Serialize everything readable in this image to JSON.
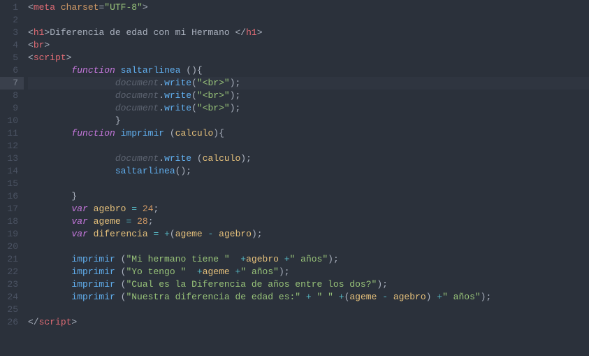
{
  "lines": [
    {
      "n": 1,
      "hl": false,
      "s": [
        [
          "p",
          "<"
        ],
        [
          "t",
          "meta"
        ],
        [
          "p",
          " "
        ],
        [
          "a",
          "charset"
        ],
        [
          "p",
          "="
        ],
        [
          "s",
          "\"UTF-8\""
        ],
        [
          "p",
          ">"
        ]
      ]
    },
    {
      "n": 2,
      "hl": false,
      "s": []
    },
    {
      "n": 3,
      "hl": false,
      "s": [
        [
          "p",
          "<"
        ],
        [
          "t",
          "h1"
        ],
        [
          "p",
          ">"
        ],
        [
          "p",
          "Diferencia de edad con mi Hermano "
        ],
        [
          "p",
          "</"
        ],
        [
          "t",
          "h1"
        ],
        [
          "p",
          ">"
        ]
      ]
    },
    {
      "n": 4,
      "hl": false,
      "s": [
        [
          "p",
          "<"
        ],
        [
          "t",
          "br"
        ],
        [
          "p",
          ">"
        ]
      ]
    },
    {
      "n": 5,
      "hl": false,
      "s": [
        [
          "p",
          "<"
        ],
        [
          "t",
          "script"
        ],
        [
          "p",
          ">"
        ]
      ]
    },
    {
      "n": 6,
      "hl": false,
      "s": [
        [
          "p",
          "        "
        ],
        [
          "k",
          "function"
        ],
        [
          "p",
          " "
        ],
        [
          "fn",
          "saltarlinea"
        ],
        [
          "p",
          " (){ "
        ]
      ]
    },
    {
      "n": 7,
      "hl": true,
      "s": [
        [
          "p",
          "                "
        ],
        [
          "ob",
          "document"
        ],
        [
          "p",
          "."
        ],
        [
          "fn",
          "write"
        ],
        [
          "p",
          "("
        ],
        [
          "s",
          "\"<br>\""
        ],
        [
          "p",
          ");"
        ]
      ]
    },
    {
      "n": 8,
      "hl": false,
      "s": [
        [
          "p",
          "                "
        ],
        [
          "ob",
          "document"
        ],
        [
          "p",
          "."
        ],
        [
          "fn",
          "write"
        ],
        [
          "p",
          "("
        ],
        [
          "s",
          "\"<br>\""
        ],
        [
          "p",
          ");"
        ]
      ]
    },
    {
      "n": 9,
      "hl": false,
      "s": [
        [
          "p",
          "                "
        ],
        [
          "ob",
          "document"
        ],
        [
          "p",
          "."
        ],
        [
          "fn",
          "write"
        ],
        [
          "p",
          "("
        ],
        [
          "s",
          "\"<br>\""
        ],
        [
          "p",
          ");"
        ]
      ]
    },
    {
      "n": 10,
      "hl": false,
      "s": [
        [
          "p",
          "                }"
        ]
      ]
    },
    {
      "n": 11,
      "hl": false,
      "s": [
        [
          "p",
          "        "
        ],
        [
          "k",
          "function"
        ],
        [
          "p",
          " "
        ],
        [
          "fn",
          "imprimir"
        ],
        [
          "p",
          " ("
        ],
        [
          "id",
          "calculo"
        ],
        [
          "p",
          "){ "
        ]
      ]
    },
    {
      "n": 12,
      "hl": false,
      "s": []
    },
    {
      "n": 13,
      "hl": false,
      "s": [
        [
          "p",
          "                "
        ],
        [
          "ob",
          "document"
        ],
        [
          "p",
          "."
        ],
        [
          "fn",
          "write"
        ],
        [
          "p",
          " ("
        ],
        [
          "id",
          "calculo"
        ],
        [
          "p",
          ");"
        ]
      ]
    },
    {
      "n": 14,
      "hl": false,
      "s": [
        [
          "p",
          "                "
        ],
        [
          "fn",
          "saltarlinea"
        ],
        [
          "p",
          "();"
        ]
      ]
    },
    {
      "n": 15,
      "hl": false,
      "s": []
    },
    {
      "n": 16,
      "hl": false,
      "s": [
        [
          "p",
          "        }"
        ]
      ]
    },
    {
      "n": 17,
      "hl": false,
      "s": [
        [
          "p",
          "        "
        ],
        [
          "k",
          "var"
        ],
        [
          "p",
          " "
        ],
        [
          "id",
          "agebro"
        ],
        [
          "p",
          " "
        ],
        [
          "op",
          "="
        ],
        [
          "p",
          " "
        ],
        [
          "a",
          "24"
        ],
        [
          "p",
          ";"
        ]
      ]
    },
    {
      "n": 18,
      "hl": false,
      "s": [
        [
          "p",
          "        "
        ],
        [
          "k",
          "var"
        ],
        [
          "p",
          " "
        ],
        [
          "id",
          "ageme"
        ],
        [
          "p",
          " "
        ],
        [
          "op",
          "="
        ],
        [
          "p",
          " "
        ],
        [
          "a",
          "28"
        ],
        [
          "p",
          ";"
        ]
      ]
    },
    {
      "n": 19,
      "hl": false,
      "s": [
        [
          "p",
          "        "
        ],
        [
          "k",
          "var"
        ],
        [
          "p",
          " "
        ],
        [
          "id",
          "diferencia"
        ],
        [
          "p",
          " "
        ],
        [
          "op",
          "="
        ],
        [
          "p",
          " "
        ],
        [
          "op",
          "+"
        ],
        [
          "p",
          "("
        ],
        [
          "id",
          "ageme"
        ],
        [
          "p",
          " "
        ],
        [
          "op",
          "-"
        ],
        [
          "p",
          " "
        ],
        [
          "id",
          "agebro"
        ],
        [
          "p",
          ");"
        ]
      ]
    },
    {
      "n": 20,
      "hl": false,
      "s": []
    },
    {
      "n": 21,
      "hl": false,
      "s": [
        [
          "p",
          "        "
        ],
        [
          "fn",
          "imprimir"
        ],
        [
          "p",
          " ("
        ],
        [
          "s",
          "\"Mi hermano tiene \""
        ],
        [
          "p",
          "  "
        ],
        [
          "op",
          "+"
        ],
        [
          "id",
          "agebro"
        ],
        [
          "p",
          " "
        ],
        [
          "op",
          "+"
        ],
        [
          "s",
          "\" años\""
        ],
        [
          "p",
          ");"
        ]
      ]
    },
    {
      "n": 22,
      "hl": false,
      "s": [
        [
          "p",
          "        "
        ],
        [
          "fn",
          "imprimir"
        ],
        [
          "p",
          " ("
        ],
        [
          "s",
          "\"Yo tengo \""
        ],
        [
          "p",
          "  "
        ],
        [
          "op",
          "+"
        ],
        [
          "id",
          "ageme"
        ],
        [
          "p",
          " "
        ],
        [
          "op",
          "+"
        ],
        [
          "s",
          "\" años\""
        ],
        [
          "p",
          ");"
        ]
      ]
    },
    {
      "n": 23,
      "hl": false,
      "s": [
        [
          "p",
          "        "
        ],
        [
          "fn",
          "imprimir"
        ],
        [
          "p",
          " ("
        ],
        [
          "s",
          "\"Cual es la Diferencia de años entre los dos?\""
        ],
        [
          "p",
          ");"
        ]
      ]
    },
    {
      "n": 24,
      "hl": false,
      "s": [
        [
          "p",
          "        "
        ],
        [
          "fn",
          "imprimir"
        ],
        [
          "p",
          " ("
        ],
        [
          "s",
          "\"Nuestra diferencia de edad es:\""
        ],
        [
          "p",
          " "
        ],
        [
          "op",
          "+"
        ],
        [
          "p",
          " "
        ],
        [
          "s",
          "\" \""
        ],
        [
          "p",
          " "
        ],
        [
          "op",
          "+"
        ],
        [
          "p",
          "("
        ],
        [
          "id",
          "ageme"
        ],
        [
          "p",
          " "
        ],
        [
          "op",
          "-"
        ],
        [
          "p",
          " "
        ],
        [
          "id",
          "agebro"
        ],
        [
          "p",
          ") "
        ],
        [
          "op",
          "+"
        ],
        [
          "s",
          "\" años\""
        ],
        [
          "p",
          ");"
        ]
      ]
    },
    {
      "n": 25,
      "hl": false,
      "s": []
    },
    {
      "n": 26,
      "hl": false,
      "s": [
        [
          "p",
          "</"
        ],
        [
          "t",
          "script"
        ],
        [
          "p",
          ">"
        ]
      ]
    }
  ]
}
